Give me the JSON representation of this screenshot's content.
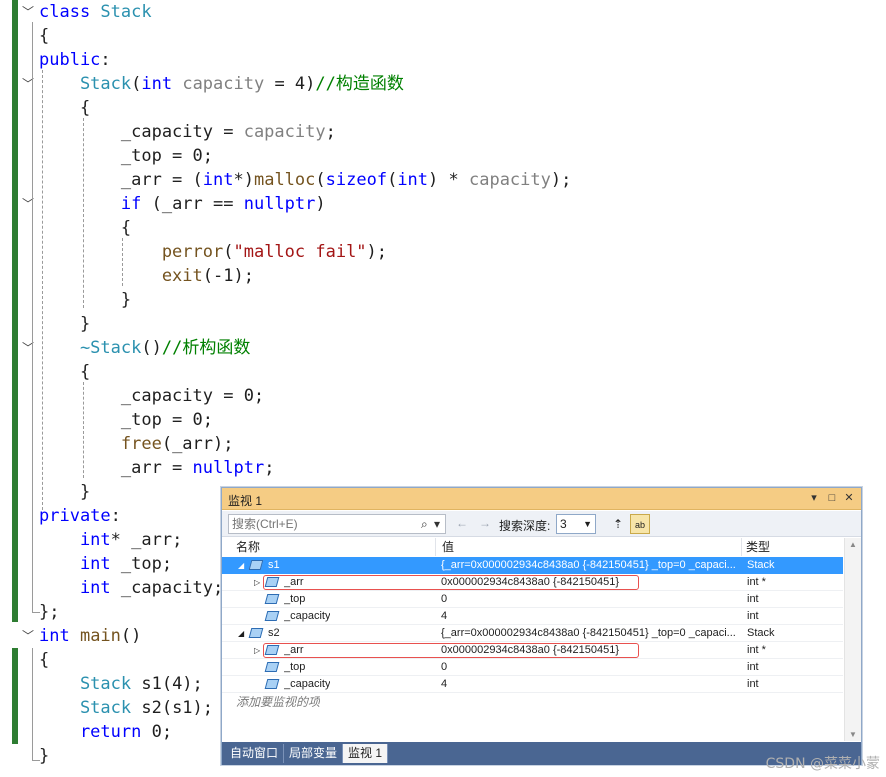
{
  "code": {
    "lines": [
      [
        {
          "t": "class ",
          "c": "kw"
        },
        {
          "t": "Stack",
          "c": "ty"
        }
      ],
      [
        {
          "t": "{",
          "c": "nm"
        }
      ],
      [
        {
          "t": "public",
          "c": "kw"
        },
        {
          "t": ":",
          "c": "nm"
        }
      ],
      [
        {
          "t": "    Stack",
          "c": "ty"
        },
        {
          "t": "(",
          "c": "nm"
        },
        {
          "t": "int",
          "c": "kw"
        },
        {
          "t": " capacity",
          "c": "pm"
        },
        {
          "t": " = 4)",
          "c": "nm"
        },
        {
          "t": "//构造函数",
          "c": "cm"
        }
      ],
      [
        {
          "t": "    {",
          "c": "nm"
        }
      ],
      [
        {
          "t": "        _capacity = ",
          "c": "nm"
        },
        {
          "t": "capacity",
          "c": "pm"
        },
        {
          "t": ";",
          "c": "nm"
        }
      ],
      [
        {
          "t": "        _top = 0;",
          "c": "nm"
        }
      ],
      [
        {
          "t": "        _arr = (",
          "c": "nm"
        },
        {
          "t": "int",
          "c": "kw"
        },
        {
          "t": "*)",
          "c": "nm"
        },
        {
          "t": "malloc",
          "c": "fn"
        },
        {
          "t": "(",
          "c": "nm"
        },
        {
          "t": "sizeof",
          "c": "kw"
        },
        {
          "t": "(",
          "c": "nm"
        },
        {
          "t": "int",
          "c": "kw"
        },
        {
          "t": ") * ",
          "c": "nm"
        },
        {
          "t": "capacity",
          "c": "pm"
        },
        {
          "t": ");",
          "c": "nm"
        }
      ],
      [
        {
          "t": "        if",
          "c": "kw"
        },
        {
          "t": " (_arr == ",
          "c": "nm"
        },
        {
          "t": "nullptr",
          "c": "kw"
        },
        {
          "t": ")",
          "c": "nm"
        }
      ],
      [
        {
          "t": "        {",
          "c": "nm"
        }
      ],
      [
        {
          "t": "            perror",
          "c": "fn"
        },
        {
          "t": "(",
          "c": "nm"
        },
        {
          "t": "\"malloc fail\"",
          "c": "st"
        },
        {
          "t": ");",
          "c": "nm"
        }
      ],
      [
        {
          "t": "            exit",
          "c": "fn"
        },
        {
          "t": "(-1);",
          "c": "nm"
        }
      ],
      [
        {
          "t": "        }",
          "c": "nm"
        }
      ],
      [
        {
          "t": "    }",
          "c": "nm"
        }
      ],
      [
        {
          "t": "    ~Stack",
          "c": "ty"
        },
        {
          "t": "()",
          "c": "nm"
        },
        {
          "t": "//析构函数",
          "c": "cm"
        }
      ],
      [
        {
          "t": "    {",
          "c": "nm"
        }
      ],
      [
        {
          "t": "        _capacity = 0;",
          "c": "nm"
        }
      ],
      [
        {
          "t": "        _top = 0;",
          "c": "nm"
        }
      ],
      [
        {
          "t": "        free",
          "c": "fn"
        },
        {
          "t": "(_arr);",
          "c": "nm"
        }
      ],
      [
        {
          "t": "        _arr = ",
          "c": "nm"
        },
        {
          "t": "nullptr",
          "c": "kw"
        },
        {
          "t": ";",
          "c": "nm"
        }
      ],
      [
        {
          "t": "    }",
          "c": "nm"
        }
      ],
      [
        {
          "t": "private",
          "c": "kw"
        },
        {
          "t": ":",
          "c": "nm"
        }
      ],
      [
        {
          "t": "    int",
          "c": "kw"
        },
        {
          "t": "* _arr;",
          "c": "nm"
        }
      ],
      [
        {
          "t": "    int",
          "c": "kw"
        },
        {
          "t": " _top;",
          "c": "nm"
        }
      ],
      [
        {
          "t": "    int",
          "c": "kw"
        },
        {
          "t": " _capacity;",
          "c": "nm"
        }
      ],
      [
        {
          "t": "};",
          "c": "nm"
        }
      ],
      [
        {
          "t": "int",
          "c": "kw"
        },
        {
          "t": " main",
          "c": "fn"
        },
        {
          "t": "()",
          "c": "nm"
        }
      ],
      [
        {
          "t": "{",
          "c": "nm"
        }
      ],
      [
        {
          "t": "    Stack",
          "c": "ty"
        },
        {
          "t": " s1(4);",
          "c": "nm"
        }
      ],
      [
        {
          "t": "    Stack",
          "c": "ty"
        },
        {
          "t": " s2(s1);",
          "c": "nm"
        }
      ],
      [
        {
          "t": "    return",
          "c": "kw"
        },
        {
          "t": " 0;",
          "c": "nm"
        }
      ],
      [
        {
          "t": "}",
          "c": "nm"
        }
      ]
    ]
  },
  "watch": {
    "title": "监视 1",
    "title_buttons": {
      "dropdown": "▾",
      "maximize": "□",
      "close": "✕"
    },
    "search": {
      "placeholder": "搜索(Ctrl+E)",
      "search_icon": "⌕",
      "dropdown_icon": "▾",
      "back_icon": "←",
      "forward_icon": "→"
    },
    "depth_label": "搜索深度:",
    "depth_value": "3",
    "columns": {
      "name": "名称",
      "value": "值",
      "type": "类型"
    },
    "rows": [
      {
        "name": "s1",
        "value": "{_arr=0x000002934c8438a0 {-842150451} _top=0 _capaci...",
        "type": "Stack",
        "expand": "◢",
        "selected": true,
        "level": 0
      },
      {
        "name": "_arr",
        "value": "0x000002934c8438a0 {-842150451}",
        "type": "int *",
        "expand": "▷",
        "selected": false,
        "level": 1,
        "highlight": true
      },
      {
        "name": "_top",
        "value": "0",
        "type": "int",
        "expand": "",
        "selected": false,
        "level": 1
      },
      {
        "name": "_capacity",
        "value": "4",
        "type": "int",
        "expand": "",
        "selected": false,
        "level": 1
      },
      {
        "name": "s2",
        "value": "{_arr=0x000002934c8438a0 {-842150451} _top=0 _capaci...",
        "type": "Stack",
        "expand": "◢",
        "selected": false,
        "level": 0
      },
      {
        "name": "_arr",
        "value": "0x000002934c8438a0 {-842150451}",
        "type": "int *",
        "expand": "▷",
        "selected": false,
        "level": 1,
        "highlight": true
      },
      {
        "name": "_top",
        "value": "0",
        "type": "int",
        "expand": "",
        "selected": false,
        "level": 1
      },
      {
        "name": "_capacity",
        "value": "4",
        "type": "int",
        "expand": "",
        "selected": false,
        "level": 1
      }
    ],
    "add_watch_placeholder": "添加要监视的项",
    "tabs": [
      "自动窗口",
      "局部变量",
      "监视 1"
    ],
    "active_tab": 2
  },
  "watermark": "CSDN @菜菜小蒙",
  "colors": {
    "selection": "#3399ff",
    "title_bar": "#f5cc84",
    "tab_strip": "#4a6692",
    "change_bar": "#2e7d32",
    "highlight_box": "#e8514f"
  }
}
